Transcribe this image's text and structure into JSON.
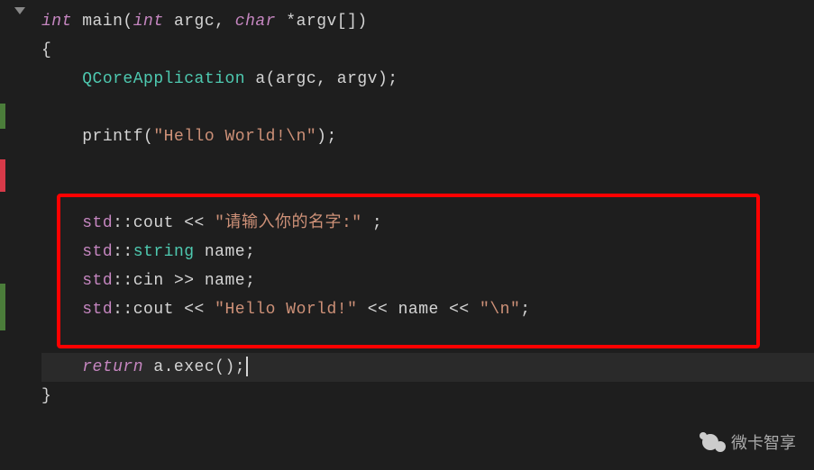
{
  "code": {
    "line1": {
      "kw1": "int",
      "func": " main",
      "paren_open": "(",
      "kw2": "int",
      "param1": " argc, ",
      "kw3": "char",
      "param2": " *argv[]",
      "paren_close": ")"
    },
    "line2": {
      "brace": "{"
    },
    "line3": {
      "indent": "    ",
      "type": "QCoreApplication",
      "rest": " a(argc, argv);"
    },
    "line4": {
      "content": ""
    },
    "line5": {
      "indent": "    ",
      "call": "printf(",
      "string": "\"Hello World!\\n\"",
      "end": ");"
    },
    "line6": {
      "content": ""
    },
    "line7": {
      "content": ""
    },
    "line8": {
      "indent": "    ",
      "ns": "std",
      "colon": "::",
      "member": "cout ",
      "op": "<< ",
      "string": "\"请输入你的名字:\"",
      "end": " ;"
    },
    "line9": {
      "indent": "    ",
      "ns": "std",
      "colon": "::",
      "type": "string",
      "rest": " name;"
    },
    "line10": {
      "indent": "    ",
      "ns": "std",
      "colon": "::",
      "member": "cin ",
      "op": ">>",
      "rest": " name;"
    },
    "line11": {
      "indent": "    ",
      "ns": "std",
      "colon": "::",
      "member": "cout ",
      "op1": "<< ",
      "string1": "\"Hello World!\"",
      "op2": " << ",
      "var": "name",
      "op3": " << ",
      "string2": "\"\\n\"",
      "end": ";"
    },
    "line12": {
      "content": ""
    },
    "line13": {
      "indent": "    ",
      "kw": "return",
      "rest": " a.exec();"
    },
    "line14": {
      "brace": "}"
    }
  },
  "watermark": {
    "text": "微卡智享"
  }
}
